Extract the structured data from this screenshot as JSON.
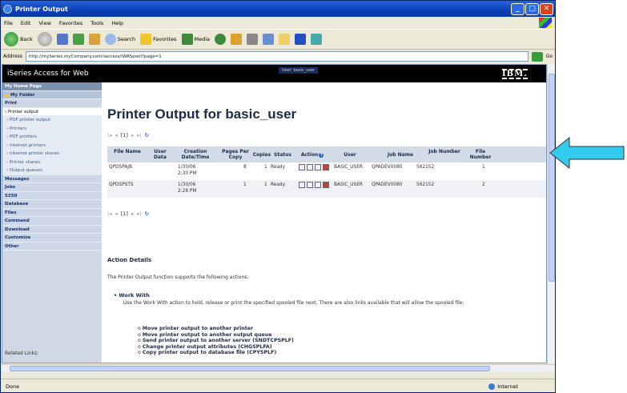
{
  "window": {
    "title": "Printer Output",
    "buttons": [
      "_",
      "□",
      "✕"
    ]
  },
  "menu": [
    "File",
    "Edit",
    "View",
    "Favorites",
    "Tools",
    "Help"
  ],
  "toolbar": {
    "back": "Back",
    "search": "Search",
    "favorites": "Favorites",
    "media": "Media"
  },
  "address": {
    "label": "Address",
    "url": "http://mySeries.myCompany.com/iaccess/iWASpool?page=1",
    "go": "Go"
  },
  "app": {
    "brand": "iSeries Access for Web",
    "user_badge": "User: basic_user",
    "logo": "IBM."
  },
  "sidebar": {
    "items": [
      {
        "label": "My Home Page",
        "kind": "hdr"
      },
      {
        "label": "My Folder",
        "kind": "folder"
      },
      {
        "label": "Print",
        "kind": "cat"
      },
      {
        "label": "› Printer output",
        "kind": "active"
      },
      {
        "label": "› PDF printer output",
        "kind": "sub"
      },
      {
        "label": "› Printers",
        "kind": "sub"
      },
      {
        "label": "› PDF printers",
        "kind": "sub"
      },
      {
        "label": "› Internet printers",
        "kind": "sub"
      },
      {
        "label": "› Internet printer shares",
        "kind": "sub"
      },
      {
        "label": "› Printer shares",
        "kind": "sub"
      },
      {
        "label": "› Output queues",
        "kind": "sub"
      },
      {
        "label": "Messages",
        "kind": "cat"
      },
      {
        "label": "Jobs",
        "kind": "cat"
      },
      {
        "label": "5250",
        "kind": "cat"
      },
      {
        "label": "Database",
        "kind": "cat"
      },
      {
        "label": "Files",
        "kind": "cat"
      },
      {
        "label": "Command",
        "kind": "cat"
      },
      {
        "label": "Download",
        "kind": "cat"
      },
      {
        "label": "Customize",
        "kind": "cat"
      },
      {
        "label": "Other",
        "kind": "cat"
      }
    ],
    "related": "Related Links:"
  },
  "main": {
    "title": "Printer Output for basic_user",
    "pager": {
      "first": "|◂",
      "prev": "◂",
      "page": "[1]",
      "next": "▸",
      "last": "▸|",
      "refresh": "↻"
    },
    "columns": [
      "File Name",
      "User Data",
      "Creation Date/Time",
      "Pages Per Copy",
      "Copies",
      "Status",
      "Action",
      "User",
      "Job Name",
      "Job Number",
      "File Number"
    ],
    "rows": [
      {
        "file": "QPDSPAJB",
        "user_data": "",
        "date": "1/30/06",
        "time": "2:30 PM",
        "pages": "8",
        "copies": "1",
        "status": "Ready",
        "user": "BASIC_USER",
        "job": "QPADEV0080",
        "jobnum": "562152",
        "filenum": "1"
      },
      {
        "file": "QPDSPSTS",
        "user_data": "",
        "date": "1/30/06",
        "time": "2:28 PM",
        "pages": "1",
        "copies": "1",
        "status": "Ready",
        "user": "BASIC_USER",
        "job": "QPADEV0080",
        "jobnum": "562152",
        "filenum": "2"
      }
    ],
    "details_title": "Action Details",
    "details_intro": "The Printer Output function supports the following actions:",
    "work_with_title": "Work With",
    "work_with_text": "Use the Work With action to hold, release or print the specified spooled file next. There are also links available that will allow the spooled file:",
    "actions": [
      "Move printer output to another printer",
      "Move printer output to another output queue",
      "Send printer output to another server (SNDTCPSPLF)",
      "Change printer output attributes (CHGSPLFA)",
      "Copy printer output to database file (CPYSPLF)"
    ]
  },
  "status": {
    "left": "Done",
    "zone": "Internet"
  },
  "colors": {
    "arrow": "#33ccee",
    "title_blue": "#0a3fb8",
    "sidebar": "#cfd8e4"
  }
}
